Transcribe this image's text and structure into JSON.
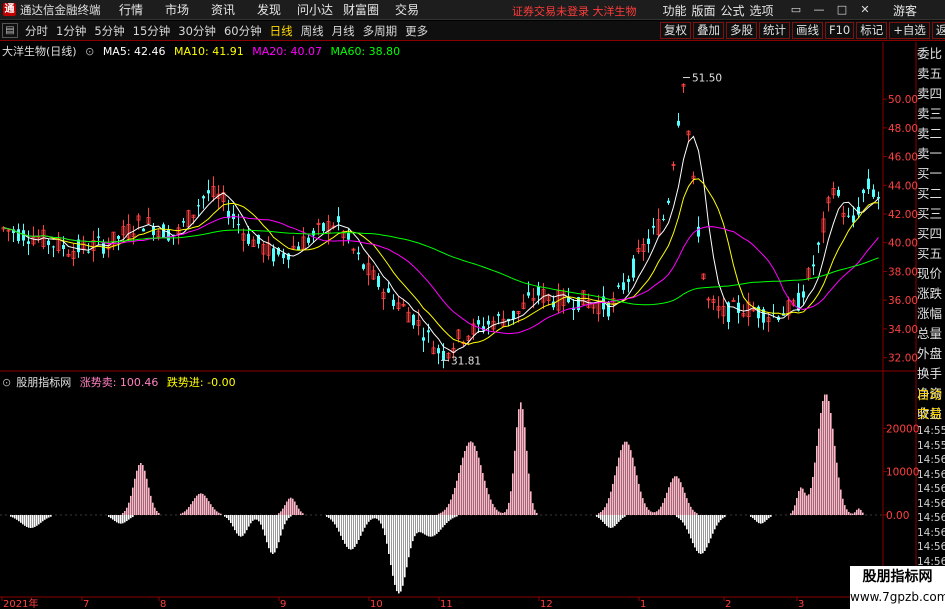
{
  "app": {
    "logo_letter": "通",
    "title": "通达信金融终端"
  },
  "menu": [
    "行情",
    "市场",
    "资讯",
    "发现",
    "问小达",
    "财富圈",
    "交易"
  ],
  "notice": "证券交易未登录  大洋生物",
  "right_menu": [
    "功能",
    "版面",
    "公式",
    "选项"
  ],
  "window_icons": [
    "▭",
    "—",
    "□",
    "✕"
  ],
  "guest": "游客",
  "period_tabs": [
    {
      "label": "分时",
      "active": false
    },
    {
      "label": "1分钟",
      "active": false
    },
    {
      "label": "5分钟",
      "active": false
    },
    {
      "label": "15分钟",
      "active": false
    },
    {
      "label": "30分钟",
      "active": false
    },
    {
      "label": "60分钟",
      "active": false
    },
    {
      "label": "日线",
      "active": true
    },
    {
      "label": "周线",
      "active": false
    },
    {
      "label": "月线",
      "active": false
    },
    {
      "label": "多周期",
      "active": false
    },
    {
      "label": "更多",
      "active": false
    }
  ],
  "toggle_icon": "▤",
  "tools": [
    "复权",
    "叠加",
    "多股",
    "统计",
    "画线",
    "F10",
    "标记",
    "+自选",
    "返回"
  ],
  "main_header": {
    "stock": "大洋生物(日线)",
    "ma5": "MA5: 42.46",
    "ma10": "MA10: 41.91",
    "ma20": "MA20: 40.07",
    "ma60": "MA60: 38.80"
  },
  "sub_header": {
    "name": "股朋指标网",
    "sell": "涨势卖: 100.46",
    "buy": "跌势进: -0.00"
  },
  "sidebar_items": [
    "委比",
    "卖五",
    "卖四",
    "卖三",
    "卖二",
    "卖一",
    "买一",
    "买二",
    "买三",
    "买四",
    "买五",
    "现价",
    "涨跌",
    "涨幅",
    "总量",
    "外盘",
    "换手",
    "净资",
    "收益"
  ],
  "sidebar2_items": [
    "自动",
    "交易"
  ],
  "times": [
    "14:55",
    "14:55",
    "14:56",
    "14:56",
    "14:56",
    "14:56",
    "14:56",
    "14:56",
    "14:56",
    "14:56",
    "14:56"
  ],
  "colors": {
    "up": "#ff4040",
    "down": "#54ffff",
    "ma5": "#ffffff",
    "ma10": "#ffff00",
    "ma20": "#ff00ff",
    "ma60": "#00ff00",
    "sell": "#ff80c0",
    "buy": "#ffff00",
    "pink": "#ffb6c8"
  },
  "chart_data": [
    {
      "type": "candlestick",
      "title": "大洋生物(日线)",
      "x": [
        "2021年",
        "7",
        "8",
        "9",
        "10",
        "11",
        "12",
        "1",
        "2",
        "3"
      ],
      "ylim": [
        31,
        53
      ],
      "y_ticks": [
        "50.00",
        "48.00",
        "46.00",
        "44.00",
        "42.00",
        "40.00",
        "38.00",
        "36.00",
        "34.00",
        "32.00"
      ],
      "annotations": [
        {
          "text": "51.50",
          "value": 51.5
        },
        {
          "text": "31.81",
          "value": 31.81
        }
      ],
      "series": [
        {
          "name": "MA5",
          "values": [
            42.46
          ]
        },
        {
          "name": "MA10",
          "values": [
            41.91
          ]
        },
        {
          "name": "MA20",
          "values": [
            40.07
          ]
        },
        {
          "name": "MA60",
          "values": [
            38.8
          ]
        }
      ],
      "grid": false
    },
    {
      "type": "bar",
      "title": "股朋指标网",
      "ylim": [
        -18000,
        27000
      ],
      "y_ticks": [
        "20000",
        "10000",
        "0.00"
      ],
      "series": [
        {
          "name": "涨势卖",
          "values": [
            100.46
          ]
        },
        {
          "name": "跌势进",
          "values": [
            -0.0
          ]
        }
      ]
    }
  ],
  "watermark": {
    "line1": "股朋指标网",
    "line2": "www.7gpzb.com"
  }
}
